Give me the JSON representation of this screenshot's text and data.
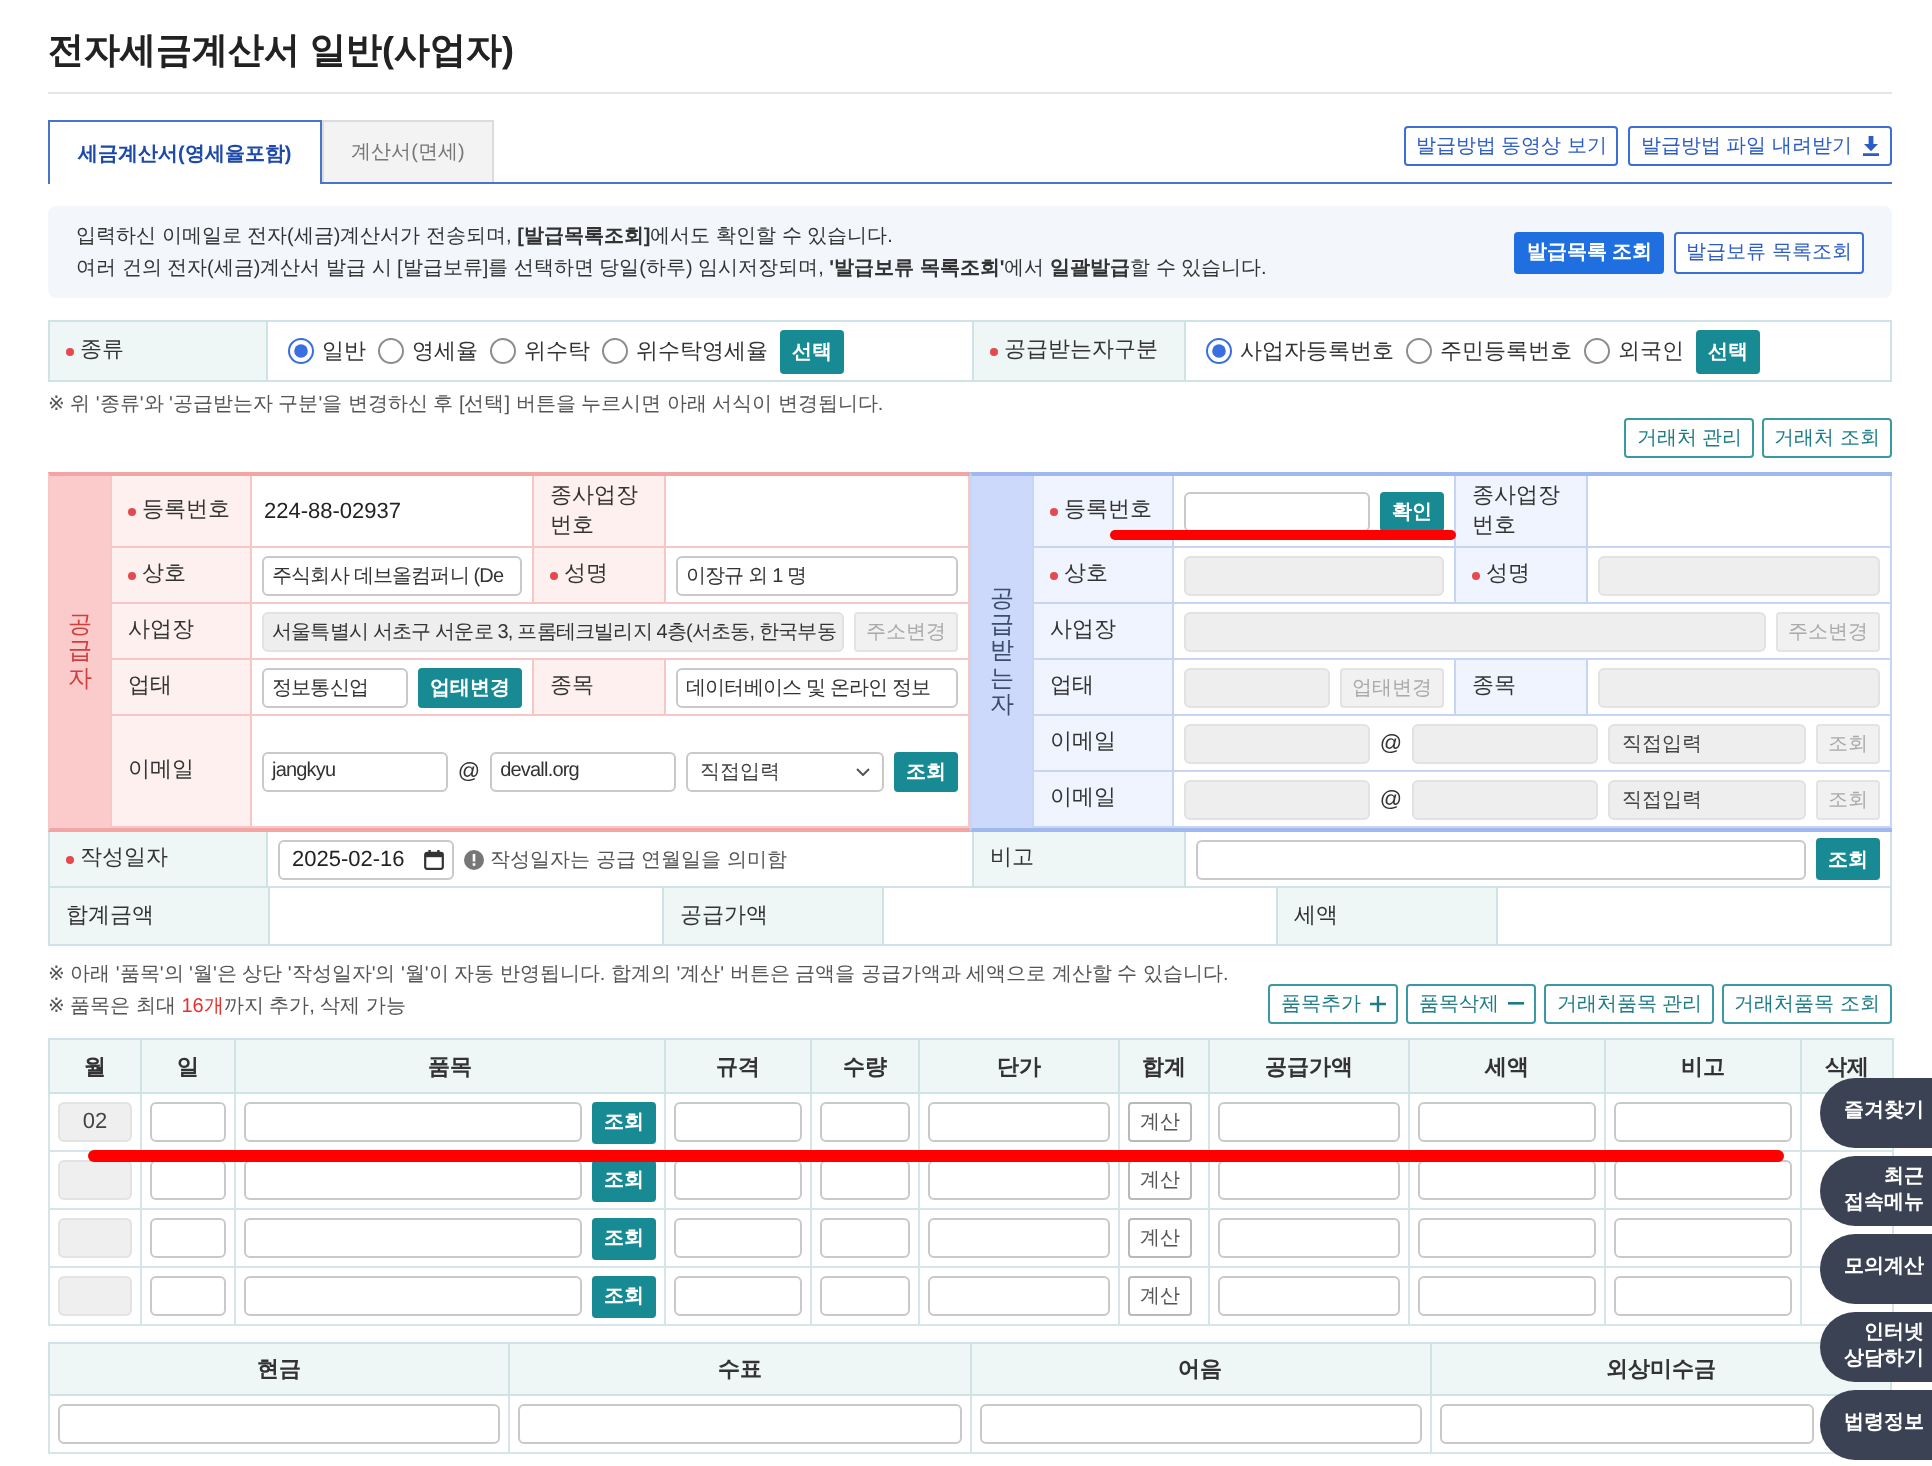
{
  "page_title": "전자세금계산서 일반(사업자)",
  "tabs": [
    {
      "label": "세금계산서(영세율포함)",
      "selected": true
    },
    {
      "label": "계산서(면세)",
      "selected": false
    }
  ],
  "guide_buttons": [
    "발급방법 동영상 보기",
    "발급방법 파일 내려받기"
  ],
  "info_box": {
    "lines": [
      "입력하신 이메일로 전자(세금)계산서가 전송되며, **[발급목록조회]**에서도 확인할 수 있습니다.",
      "여러 건의 전자(세금)계산서 발급 시 [발급보류]를 선택하면 당일(하루) 임시저장되며, **'발급보류 목록조회'**에서 **일괄발급**할 수 있습니다."
    ],
    "buttons": [
      {
        "label": "발급목록 조회",
        "primary": true
      },
      {
        "label": "발급보류 목록조회",
        "primary": false
      }
    ]
  },
  "type_row": [
    {
      "label": "종류",
      "required": true,
      "options": [
        {
          "label": "일반",
          "selected": true
        },
        {
          "label": "영세율",
          "selected": false
        },
        {
          "label": "위수탁",
          "selected": false
        },
        {
          "label": "위수탁영세율",
          "selected": false
        }
      ],
      "button": "선택"
    },
    {
      "label": "공급받는자구분",
      "required": true,
      "options": [
        {
          "label": "사업자등록번호",
          "selected": true
        },
        {
          "label": "주민등록번호",
          "selected": false
        },
        {
          "label": "외국인",
          "selected": false
        }
      ],
      "button": "선택"
    }
  ],
  "type_notice": "※ 위 '종류'와 '공급받는자 구분'을 변경하신 후 [선택] 버튼을 누르시면 아래 서식이 변경됩니다.",
  "partner_buttons": [
    "거래처 관리",
    "거래처 조회"
  ],
  "parties": [
    {
      "kind": "supplier",
      "heading": "공급자",
      "rows": [
        {
          "label": "등록번호",
          "required": true,
          "value": [
            {
              "kind": "text",
              "text": "224-88-02937"
            }
          ],
          "label2": "종사업장 번호",
          "required2": false
        },
        {
          "label": "상호",
          "required": true,
          "value": [
            {
              "kind": "input",
              "value": "주식회사 데브올컴퍼니 (De",
              "disabled": false
            }
          ],
          "label2": "성명",
          "required2": true,
          "value2": [
            {
              "kind": "input",
              "value": "이장규 외 1 명",
              "disabled": false
            }
          ]
        },
        {
          "label": "사업장",
          "required": false,
          "value": [
            {
              "kind": "input",
              "value": "서울특별시 서초구 서운로 3, 프롬테크빌리지 4층(서초동, 한국부동",
              "disabled": true
            },
            {
              "kind": "button",
              "label": "주소변경",
              "disabled": true
            }
          ]
        },
        {
          "label": "업태",
          "required": false,
          "value": [
            {
              "kind": "input",
              "value": "정보통신업",
              "disabled": false
            },
            {
              "kind": "button",
              "label": "업태변경",
              "disabled": false
            }
          ],
          "label2": "종목",
          "required2": false,
          "value2": [
            {
              "kind": "input",
              "value": "데이터베이스 및 온라인 정보",
              "disabled": false
            }
          ]
        },
        {
          "label": "이메일",
          "required": false,
          "value": [
            {
              "kind": "input",
              "value": "jangkyu",
              "disabled": false
            },
            {
              "kind": "at",
              "text": "@"
            },
            {
              "kind": "input",
              "value": "devall.org",
              "disabled": false
            },
            {
              "kind": "select",
              "value": "직접입력",
              "disabled": false
            },
            {
              "kind": "button",
              "label": "조회",
              "disabled": false
            }
          ]
        }
      ]
    },
    {
      "kind": "receiver",
      "heading": "공급받는자",
      "rows": [
        {
          "label": "등록번호",
          "required": true,
          "value": [
            {
              "kind": "input",
              "disabled": false
            },
            {
              "kind": "button",
              "label": "확인",
              "disabled": false
            }
          ],
          "label2": "종사업장 번호",
          "required2": false
        },
        {
          "label": "상호",
          "required": true,
          "value": [
            {
              "kind": "input",
              "disabled": true
            }
          ],
          "label2": "성명",
          "required2": true,
          "value2": [
            {
              "kind": "input",
              "disabled": true
            }
          ]
        },
        {
          "label": "사업장",
          "required": false,
          "value": [
            {
              "kind": "input",
              "disabled": true
            },
            {
              "kind": "button",
              "label": "주소변경",
              "disabled": true
            }
          ]
        },
        {
          "label": "업태",
          "required": false,
          "value": [
            {
              "kind": "input",
              "disabled": true
            },
            {
              "kind": "button",
              "label": "업태변경",
              "disabled": true
            }
          ],
          "label2": "종목",
          "required2": false,
          "value2": [
            {
              "kind": "input",
              "disabled": true
            }
          ]
        },
        {
          "label": "이메일",
          "required": false,
          "value": [
            {
              "kind": "input",
              "disabled": true
            },
            {
              "kind": "at",
              "text": "@"
            },
            {
              "kind": "input",
              "disabled": true
            },
            {
              "kind": "select",
              "value": "직접입력",
              "disabled": true
            },
            {
              "kind": "button",
              "label": "조회",
              "disabled": true
            }
          ]
        },
        {
          "label": "이메일",
          "required": false,
          "value": [
            {
              "kind": "input",
              "disabled": true
            },
            {
              "kind": "at",
              "text": "@"
            },
            {
              "kind": "input",
              "disabled": true
            },
            {
              "kind": "select",
              "value": "직접입력",
              "disabled": true
            },
            {
              "kind": "button",
              "label": "조회",
              "disabled": true
            }
          ]
        }
      ]
    }
  ],
  "date_row": {
    "label": "작성일자",
    "required": true,
    "date": "2025-02-16",
    "hint": "작성일자는 공급 연월일을 의미함",
    "label2": "비고",
    "button": "조회"
  },
  "totals": [
    "합계금액",
    "공급가액",
    "세액"
  ],
  "item_notes": {
    "line1": "※ 아래 '품목'의 '월'은 상단 '작성일자'의 '월'이 자동 반영됩니다. 합계의 '계산' 버튼은 금액을 공급가액과 세액으로 계산할 수 있습니다.",
    "line2_before": "※ 품목은 최대 ",
    "line2_highlight": "16개",
    "line2_after": "까지 추가, 삭제 가능"
  },
  "item_buttons": [
    "품목추가",
    "품목삭제",
    "거래처품목 관리",
    "거래처품목 조회"
  ],
  "items": {
    "columns": [
      "월",
      "일",
      "품목",
      "규격",
      "수량",
      "단가",
      "합계",
      "공급가액",
      "세액",
      "비고",
      "삭제"
    ],
    "rows": [
      {
        "month": "02",
        "lookup_button": "조회",
        "calc_button": "계산"
      },
      {
        "lookup_button": "조회",
        "calc_button": "계산"
      },
      {
        "lookup_button": "조회",
        "calc_button": "계산"
      },
      {
        "lookup_button": "조회",
        "calc_button": "계산"
      }
    ]
  },
  "payment": {
    "columns": [
      "현금",
      "수표",
      "어음",
      "외상미수금"
    ]
  },
  "side_menu": [
    "즐겨찾기",
    "최근 접속메뉴",
    "모의계산",
    "인터넷 상담하기",
    "법령정보"
  ]
}
